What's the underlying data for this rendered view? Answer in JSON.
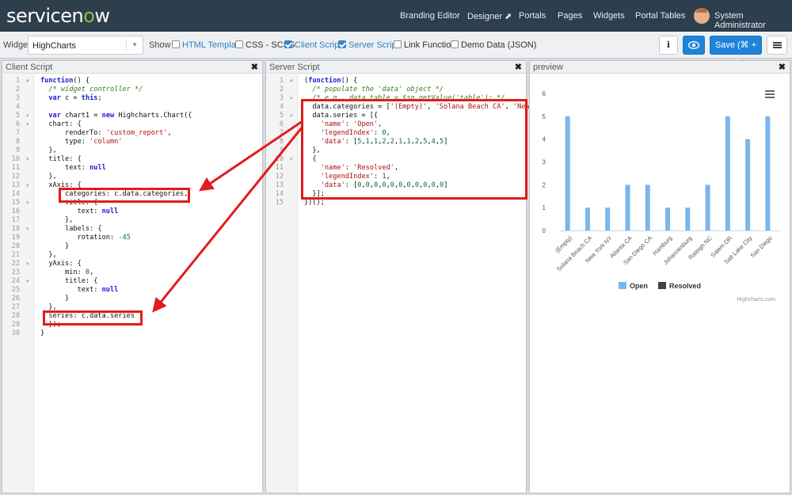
{
  "topnav": {
    "logo_text": "servicenow",
    "links": [
      "Branding Editor",
      "Designer",
      "Portals",
      "Pages",
      "Widgets",
      "Portal Tables"
    ],
    "user_name": "System Administrator"
  },
  "toolbar": {
    "widget_label": "Widget",
    "widget_value": "HighCharts",
    "show_label": "Show",
    "options": [
      {
        "label": "HTML Template",
        "checked": false
      },
      {
        "label": "CSS - SCSS",
        "checked": false
      },
      {
        "label": "Client Script",
        "checked": true
      },
      {
        "label": "Server Script",
        "checked": true
      },
      {
        "label": "Link Function",
        "checked": false
      },
      {
        "label": "Demo Data (JSON)",
        "checked": false
      }
    ],
    "info_label": "i",
    "save_label": "Save (⌘ + s)"
  },
  "client_pane": {
    "title": "Client Script",
    "close": "✖",
    "lines": [
      "function() {",
      "  /* widget controller */",
      "  var c = this;",
      "",
      "  var chart1 = new Highcharts.Chart({",
      "  chart: {",
      "      renderTo: 'custom_report',",
      "      type: 'column'",
      "  },",
      "  title: {",
      "      text: null",
      "  },",
      "  xAxis: {",
      "      categories: c.data.categories,",
      "      title: {",
      "         text: null",
      "      },",
      "      labels: {",
      "         rotation: -45",
      "      }",
      "  },",
      "  yAxis: {",
      "      min: 0,",
      "      title: {",
      "         text: null",
      "      }",
      "  },",
      "  series: c.data.series",
      "  });",
      "}"
    ]
  },
  "server_pane": {
    "title": "Server Script",
    "close": "✖",
    "lines": [
      "(function() {",
      "  /* populate the 'data' object */",
      "  /* e.g., data.table = $sp.getValue('table'); */",
      "  data.categories = ['(Empty)', 'Solana Beach CA', 'New York NY'",
      "  data.series = [{",
      "    'name': 'Open',",
      "    'legendIndex': 0,",
      "    'data': [5,1,1,2,2,1,1,2,5,4,5]",
      "  },",
      "  {",
      "    'name': 'Resolved',",
      "    'legendIndex': 1,",
      "    'data': [0,0,0,0,0,0,0,0,0,0,0]",
      "  }];",
      "})();"
    ]
  },
  "preview_pane": {
    "title": "preview",
    "close": "✖",
    "credit": "Highcharts.com"
  },
  "chart_data": {
    "type": "bar",
    "categories": [
      "(Empty)",
      "Solana Beach CA",
      "New York NY",
      "Atlanta CA",
      "San Diego CA",
      "Hamburg",
      "Johannesburg",
      "Raleigh NC",
      "Salem OR",
      "Salt Lake City",
      "San Diego"
    ],
    "series": [
      {
        "name": "Open",
        "values": [
          5,
          1,
          1,
          2,
          2,
          1,
          1,
          2,
          5,
          4,
          5
        ],
        "color": "#7cb5ec"
      },
      {
        "name": "Resolved",
        "values": [
          0,
          0,
          0,
          0,
          0,
          0,
          0,
          0,
          0,
          0,
          0
        ],
        "color": "#434348"
      }
    ],
    "yticks": [
      "0",
      "1",
      "2",
      "3",
      "4",
      "5",
      "6"
    ],
    "ylim": [
      0,
      6
    ],
    "legend": "bottom-center",
    "grid": false
  },
  "colors": {
    "nav_bg": "#2d3e4d",
    "accent": "#1e83d9",
    "highlight": "#e31b1b"
  }
}
